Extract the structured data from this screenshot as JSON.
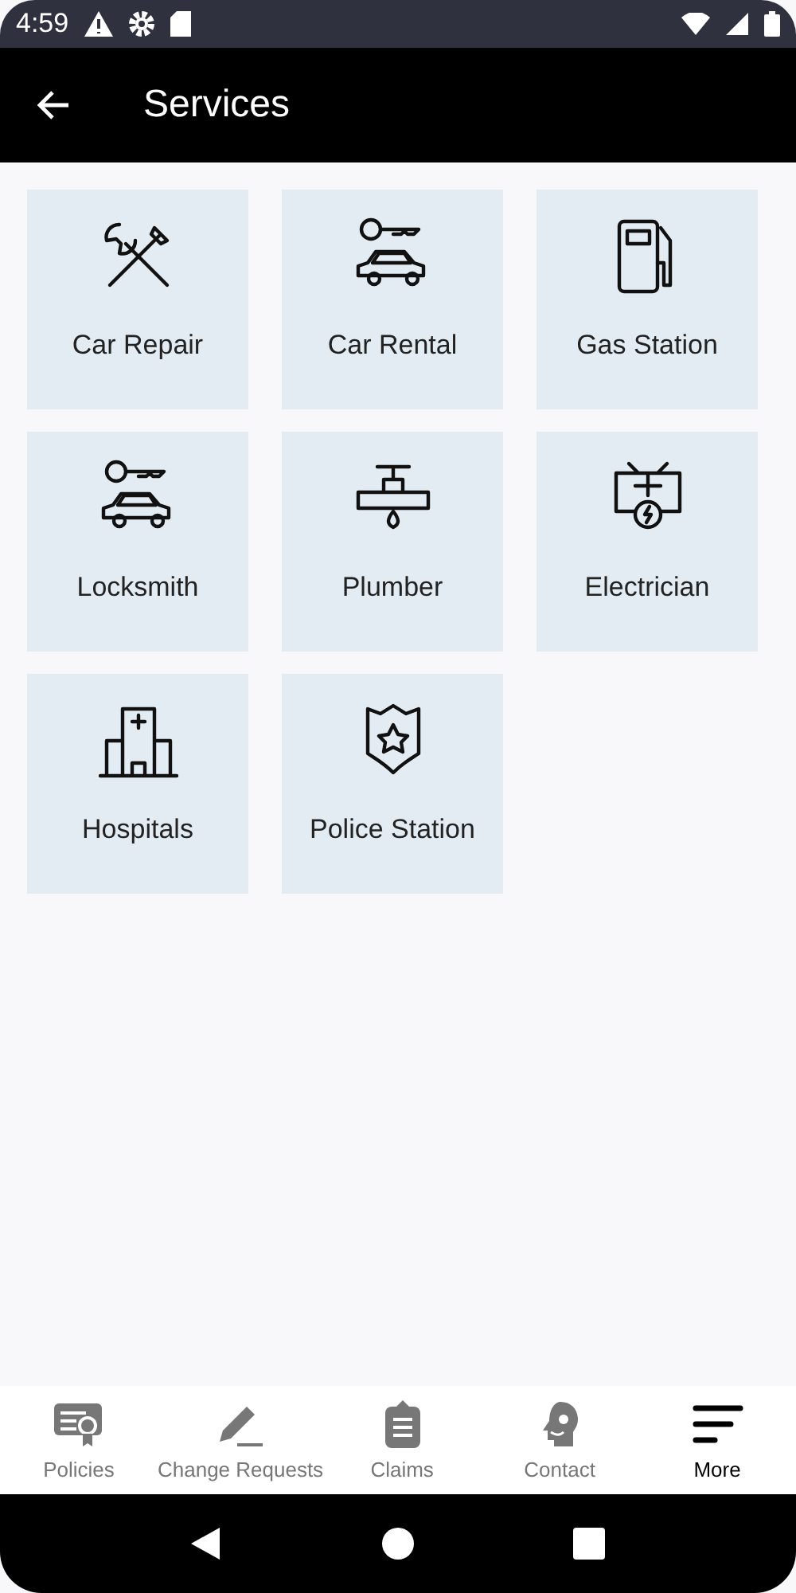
{
  "status_bar": {
    "time": "4:59"
  },
  "app_bar": {
    "title": "Services"
  },
  "services": [
    {
      "label": "Car Repair"
    },
    {
      "label": "Car Rental"
    },
    {
      "label": "Gas Station"
    },
    {
      "label": "Locksmith"
    },
    {
      "label": "Plumber"
    },
    {
      "label": "Electrician"
    },
    {
      "label": "Hospitals"
    },
    {
      "label": "Police Station"
    }
  ],
  "bottom_nav": [
    {
      "label": "Policies",
      "selected": false
    },
    {
      "label": "Change Requests",
      "selected": false
    },
    {
      "label": "Claims",
      "selected": false
    },
    {
      "label": "Contact",
      "selected": false
    },
    {
      "label": "More",
      "selected": true
    }
  ]
}
